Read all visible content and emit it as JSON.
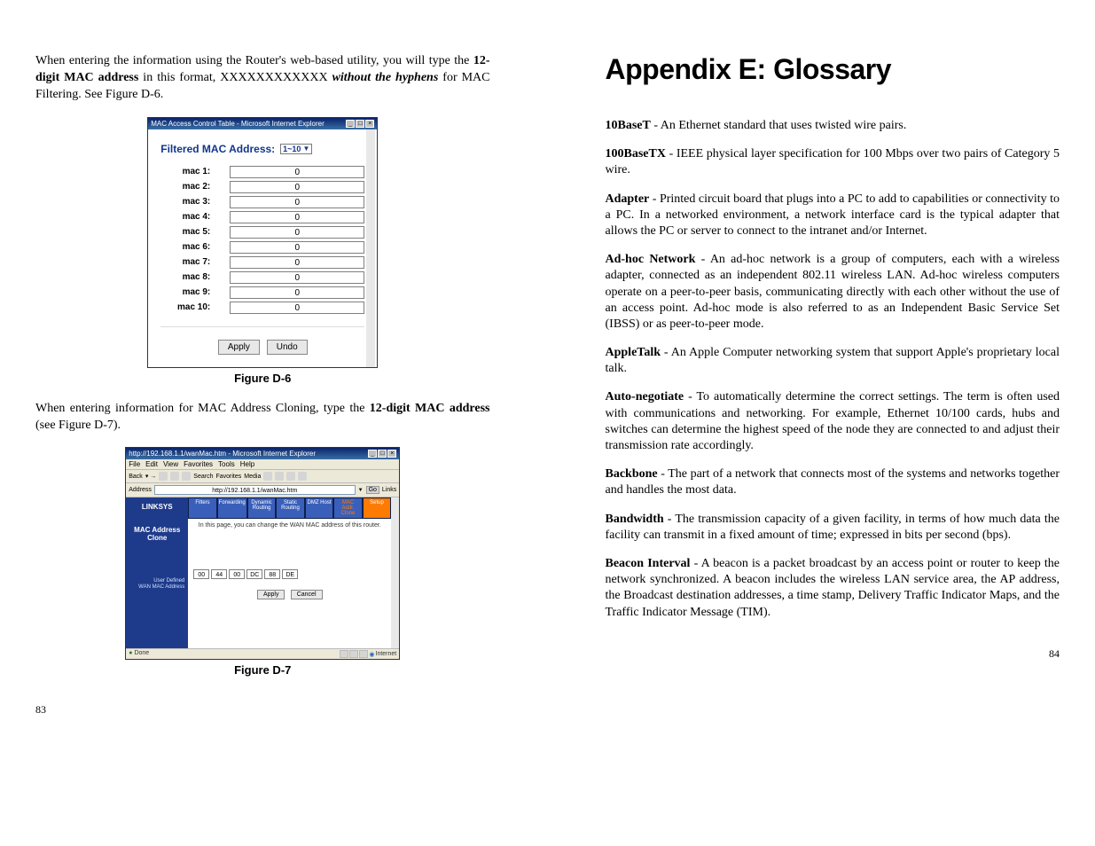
{
  "left": {
    "intro_pre": "When entering the information using the Router's web-based utility, you will type the ",
    "intro_bold1": "12-digit MAC address",
    "intro_mid": " in this format, XXXXXXXXXXXX ",
    "intro_italic": "without the hyphens",
    "intro_post": " for MAC Filtering. See Figure D-6.",
    "fig_d6": {
      "window_title": "MAC Access Control Table - Microsoft Internet Explorer",
      "filtered_label": "Filtered MAC Address:",
      "range": "1~10",
      "rows": [
        {
          "label": "mac 1:",
          "value": "0"
        },
        {
          "label": "mac 2:",
          "value": "0"
        },
        {
          "label": "mac 3:",
          "value": "0"
        },
        {
          "label": "mac 4:",
          "value": "0"
        },
        {
          "label": "mac 5:",
          "value": "0"
        },
        {
          "label": "mac 6:",
          "value": "0"
        },
        {
          "label": "mac 7:",
          "value": "0"
        },
        {
          "label": "mac 8:",
          "value": "0"
        },
        {
          "label": "mac 9:",
          "value": "0"
        },
        {
          "label": "mac 10:",
          "value": "0"
        }
      ],
      "apply": "Apply",
      "undo": "Undo",
      "caption": "Figure D-6"
    },
    "para2_pre": "When entering information for MAC Address Cloning, type the ",
    "para2_bold": "12-digit MAC address",
    "para2_post": " (see Figure D-7).",
    "fig_d7": {
      "window_title": "http://192.168.1.1/wanMac.htm - Microsoft Internet Explorer",
      "menu": [
        "File",
        "Edit",
        "View",
        "Favorites",
        "Tools",
        "Help"
      ],
      "toolbar_labels": [
        "Back",
        "",
        "",
        "",
        "Search",
        "Favorites",
        "Media",
        "",
        "",
        "",
        "",
        "",
        ""
      ],
      "address_label": "Address",
      "address_url": "http://192.168.1.1/wanMac.htm",
      "go": "Go",
      "links": "Links",
      "brand": "LINKSYS",
      "side_title": "MAC Address Clone",
      "side_sub1": "User Defined",
      "side_sub2": "WAN MAC Address",
      "tabs": [
        "Filters",
        "Forwarding",
        "Dynamic Routing",
        "Static Routing",
        "DMZ Host",
        "MAC Addr. Clone",
        "Setup"
      ],
      "desc": "In this page, you can change the WAN MAC address of this router.",
      "mac_values": [
        "00",
        "44",
        "00",
        "DC",
        "88",
        "DE"
      ],
      "apply": "Apply",
      "cancel": "Cancel",
      "status_done": "Done",
      "status_zone": "Internet",
      "caption": "Figure D-7"
    },
    "page_num": "83"
  },
  "right": {
    "title": "Appendix E: Glossary",
    "entries": [
      {
        "term": "10BaseT",
        "def": " - An Ethernet standard that uses twisted wire pairs."
      },
      {
        "term": "100BaseTX",
        "def": " - IEEE physical layer specification for 100 Mbps over two pairs of Category 5 wire."
      },
      {
        "term": "Adapter",
        "def": " - Printed circuit board that plugs into a PC to add to capabilities or connectivity to a PC. In a networked environment, a network interface card is the typical adapter that allows the PC or server to connect to the intranet and/or Internet."
      },
      {
        "term": "Ad-hoc Network",
        "def": " - An ad-hoc network is a group of computers, each with a wireless adapter, connected as an independent 802.11 wireless LAN.  Ad-hoc wireless computers operate on a peer-to-peer basis, communicating directly with each other without the use of an access point.  Ad-hoc mode is also referred to as an Independent Basic Service Set (IBSS) or as peer-to-peer mode."
      },
      {
        "term": "AppleTalk",
        "def": " - An Apple Computer networking system that support Apple's proprietary local talk."
      },
      {
        "term": "Auto-negotiate",
        "def": " - To automatically determine the correct settings. The term is often used with communications and networking. For example, Ethernet 10/100 cards, hubs and switches can determine the highest speed of the node they are connected to and adjust their transmission rate accordingly."
      },
      {
        "term": "Backbone",
        "def": " - The part of a network that connects most of the systems and networks together and handles the most data."
      },
      {
        "term": "Bandwidth",
        "def": " - The transmission capacity of a given facility, in terms of how much data the facility can transmit in a fixed amount of time; expressed in bits per second (bps)."
      },
      {
        "term": "Beacon Interval",
        "def": " -  A beacon is a packet broadcast by an access point or router to keep the network synchronized. A beacon includes the wireless LAN service area, the AP address, the Broadcast destination addresses, a time stamp, Delivery Traffic Indicator Maps, and the Traffic Indicator Message (TIM)."
      }
    ],
    "page_num": "84"
  }
}
